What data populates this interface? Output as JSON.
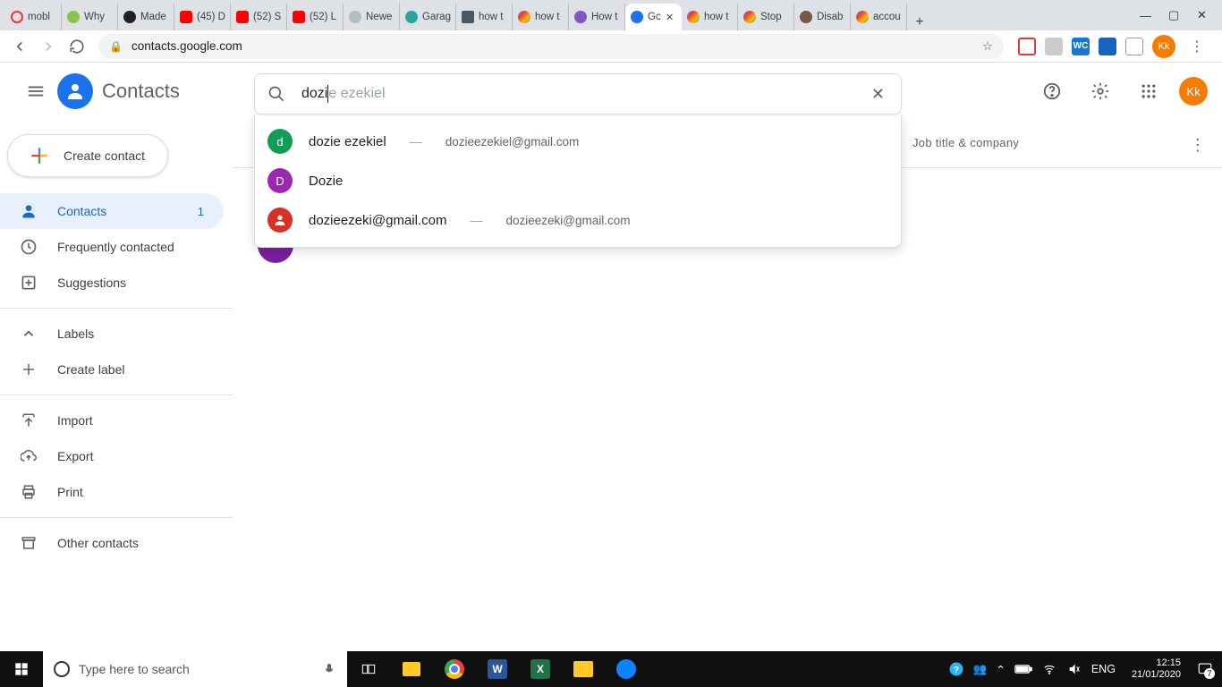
{
  "browser": {
    "tabs": [
      {
        "label": "mobl"
      },
      {
        "label": "Why"
      },
      {
        "label": "Made"
      },
      {
        "label": "(45) D"
      },
      {
        "label": "(52) S"
      },
      {
        "label": "(52) L"
      },
      {
        "label": "Newe"
      },
      {
        "label": "Garag"
      },
      {
        "label": "how t"
      },
      {
        "label": "how t"
      },
      {
        "label": "How t"
      },
      {
        "label": "Gc",
        "active": true
      },
      {
        "label": "how t"
      },
      {
        "label": "Stop"
      },
      {
        "label": "Disab"
      },
      {
        "label": "accou"
      }
    ],
    "url": "contacts.google.com",
    "profile_initials": "Kk"
  },
  "header": {
    "app_title": "Contacts",
    "search_typed": "dozi",
    "search_ghost": "e ezekiel",
    "avatar_initials": "Kk"
  },
  "dropdown": [
    {
      "avatar_letter": "d",
      "avatar_color": "#0f9d58",
      "name": "dozie ezekiel",
      "email": "dozieezekiel@gmail.com"
    },
    {
      "avatar_letter": "D",
      "avatar_color": "#9c27b0",
      "name": "Dozie",
      "email": ""
    },
    {
      "avatar_letter": "",
      "avatar_color": "#d93025",
      "name": "dozieezeki@gmail.com",
      "email": "dozieezeki@gmail.com",
      "is_person_icon": true
    }
  ],
  "sidebar": {
    "create_label": "Create contact",
    "items": [
      {
        "label": "Contacts",
        "count": "1",
        "active": true
      },
      {
        "label": "Frequently contacted"
      },
      {
        "label": "Suggestions"
      }
    ],
    "labels_header": "Labels",
    "create_label_label": "Create label",
    "import_label": "Import",
    "export_label": "Export",
    "print_label": "Print",
    "other_label": "Other contacts"
  },
  "columns": {
    "job_title": "Job title & company"
  },
  "taskbar": {
    "search_placeholder": "Type here to search",
    "lang": "ENG",
    "time": "12:15",
    "date": "21/01/2020",
    "notif_count": "7"
  }
}
